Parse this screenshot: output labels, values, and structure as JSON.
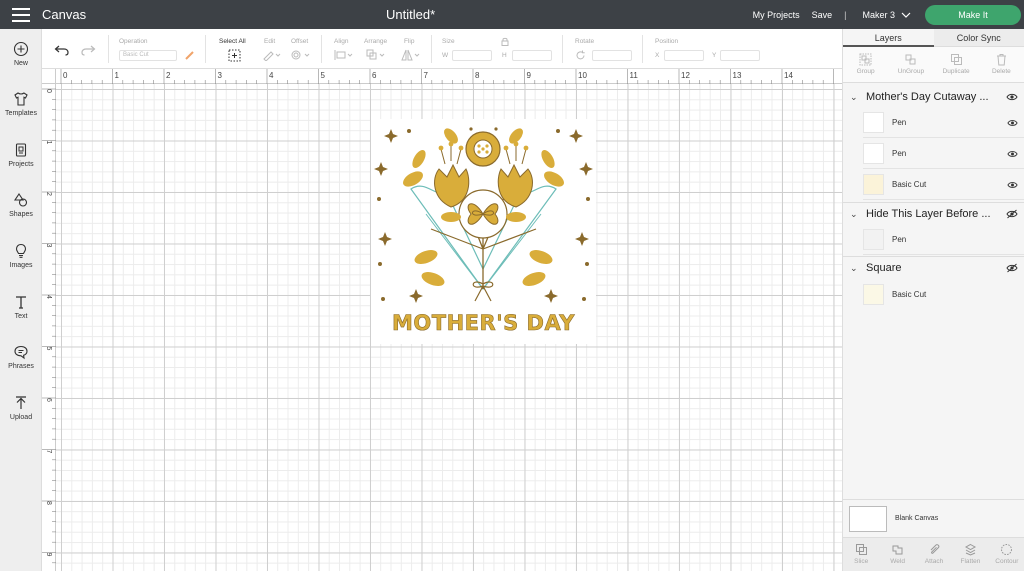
{
  "topbar": {
    "app_title": "Canvas",
    "doc_title": "Untitled*",
    "my_projects": "My Projects",
    "save": "Save",
    "separator": "|",
    "machine": "Maker 3",
    "make_it": "Make It"
  },
  "sidebar": {
    "items": [
      {
        "label": "New",
        "icon": "plus-circle-icon"
      },
      {
        "label": "Templates",
        "icon": "tshirt-icon"
      },
      {
        "label": "Projects",
        "icon": "projects-icon"
      },
      {
        "label": "Shapes",
        "icon": "shapes-icon"
      },
      {
        "label": "Images",
        "icon": "lightbulb-icon"
      },
      {
        "label": "Text",
        "icon": "text-icon"
      },
      {
        "label": "Phrases",
        "icon": "speech-bubble-icon"
      },
      {
        "label": "Upload",
        "icon": "upload-icon"
      }
    ]
  },
  "toolbar": {
    "operation_label": "Operation",
    "operation_value": "Basic Cut",
    "select_all": "Select All",
    "edit": "Edit",
    "offset": "Offset",
    "align": "Align",
    "arrange": "Arrange",
    "flip": "Flip",
    "size": "Size",
    "w": "W",
    "h": "H",
    "rotate": "Rotate",
    "position": "Position",
    "x": "X",
    "y": "Y"
  },
  "rulers": {
    "h": [
      "0",
      "1",
      "2",
      "3",
      "4",
      "5",
      "6",
      "7",
      "8",
      "9",
      "10",
      "11",
      "12",
      "13",
      "14"
    ],
    "v": [
      "0",
      "1",
      "2",
      "3",
      "4",
      "5",
      "6",
      "7",
      "8",
      "9"
    ]
  },
  "design": {
    "text": "MOTHER'S DAY"
  },
  "colors": {
    "gold": "#d9ad3a",
    "brown": "#8a6a2c",
    "teal": "#6dbdb8",
    "make_it": "#3ea56d",
    "topbar": "#3d4146"
  },
  "layers_panel": {
    "tab_layers": "Layers",
    "tab_color_sync": "Color Sync",
    "actions": [
      "Group",
      "UnGroup",
      "Duplicate",
      "Delete"
    ],
    "groups": [
      {
        "name": "Mother's Day Cutaway ...",
        "eye": "visible",
        "layers": [
          {
            "name": "Pen"
          },
          {
            "name": "Pen"
          },
          {
            "name": "Basic Cut"
          }
        ]
      },
      {
        "name": "Hide This Layer Before ...",
        "eye": "hidden",
        "layers": [
          {
            "name": "Pen"
          }
        ]
      },
      {
        "name": "Square",
        "eye": "hidden",
        "layers": [
          {
            "name": "Basic Cut"
          }
        ]
      }
    ],
    "blank_canvas": "Blank Canvas",
    "bottom_actions": [
      "Slice",
      "Weld",
      "Attach",
      "Flatten",
      "Contour"
    ]
  }
}
